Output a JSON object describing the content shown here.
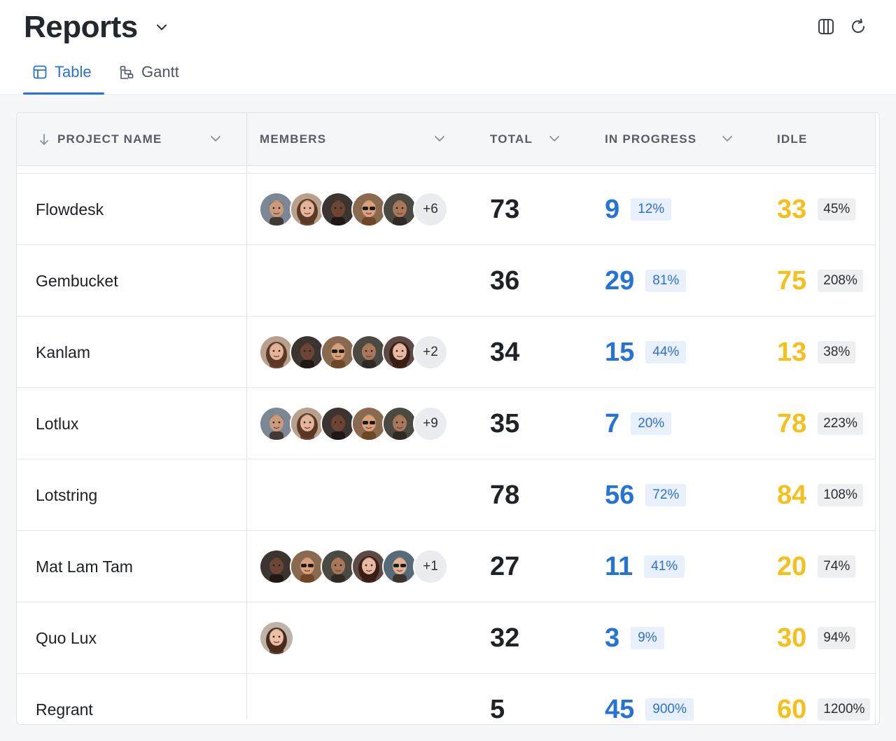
{
  "header": {
    "title": "Reports",
    "icons": [
      "columns-icon",
      "refresh-icon"
    ]
  },
  "tabs": [
    {
      "label": "Table",
      "icon": "table-icon",
      "active": true
    },
    {
      "label": "Gantt",
      "icon": "gantt-icon",
      "active": false
    }
  ],
  "table": {
    "columns": {
      "project_name": "PROJECT NAME",
      "members": "MEMBERS",
      "total": "TOTAL",
      "in_progress": "IN PROGRESS",
      "idle": "IDLE"
    },
    "rows": [
      {
        "name": "Flowdesk",
        "avatars": [
          "m1",
          "f1",
          "m2",
          "f2",
          "m3"
        ],
        "more": "+6",
        "total": "73",
        "in_progress": "9",
        "in_progress_pct": "12%",
        "idle": "33",
        "idle_pct": "45%"
      },
      {
        "name": "Gembucket",
        "avatars": [],
        "more": "",
        "total": "36",
        "in_progress": "29",
        "in_progress_pct": "81%",
        "idle": "75",
        "idle_pct": "208%"
      },
      {
        "name": "Kanlam",
        "avatars": [
          "f1",
          "m2",
          "f2",
          "m3",
          "f3"
        ],
        "more": "+2",
        "total": "34",
        "in_progress": "15",
        "in_progress_pct": "44%",
        "idle": "13",
        "idle_pct": "38%"
      },
      {
        "name": "Lotlux",
        "avatars": [
          "m1",
          "f1",
          "m2",
          "f2",
          "m3"
        ],
        "more": "+9",
        "total": "35",
        "in_progress": "7",
        "in_progress_pct": "20%",
        "idle": "78",
        "idle_pct": "223%"
      },
      {
        "name": "Lotstring",
        "avatars": [],
        "more": "",
        "total": "78",
        "in_progress": "56",
        "in_progress_pct": "72%",
        "idle": "84",
        "idle_pct": "108%"
      },
      {
        "name": "Mat Lam Tam",
        "avatars": [
          "m2",
          "f2",
          "m3",
          "f3",
          "m4"
        ],
        "more": "+1",
        "total": "27",
        "in_progress": "11",
        "in_progress_pct": "41%",
        "idle": "20",
        "idle_pct": "74%"
      },
      {
        "name": "Quo Lux",
        "avatars": [
          "f4"
        ],
        "more": "",
        "total": "32",
        "in_progress": "3",
        "in_progress_pct": "9%",
        "idle": "30",
        "idle_pct": "94%"
      },
      {
        "name": "Regrant",
        "avatars": [],
        "more": "",
        "total": "5",
        "in_progress": "45",
        "in_progress_pct": "900%",
        "idle": "60",
        "idle_pct": "1200%"
      }
    ]
  },
  "colors": {
    "accent": "#2871d6",
    "in_progress": "#2673d8",
    "idle": "#f5bf1c"
  }
}
